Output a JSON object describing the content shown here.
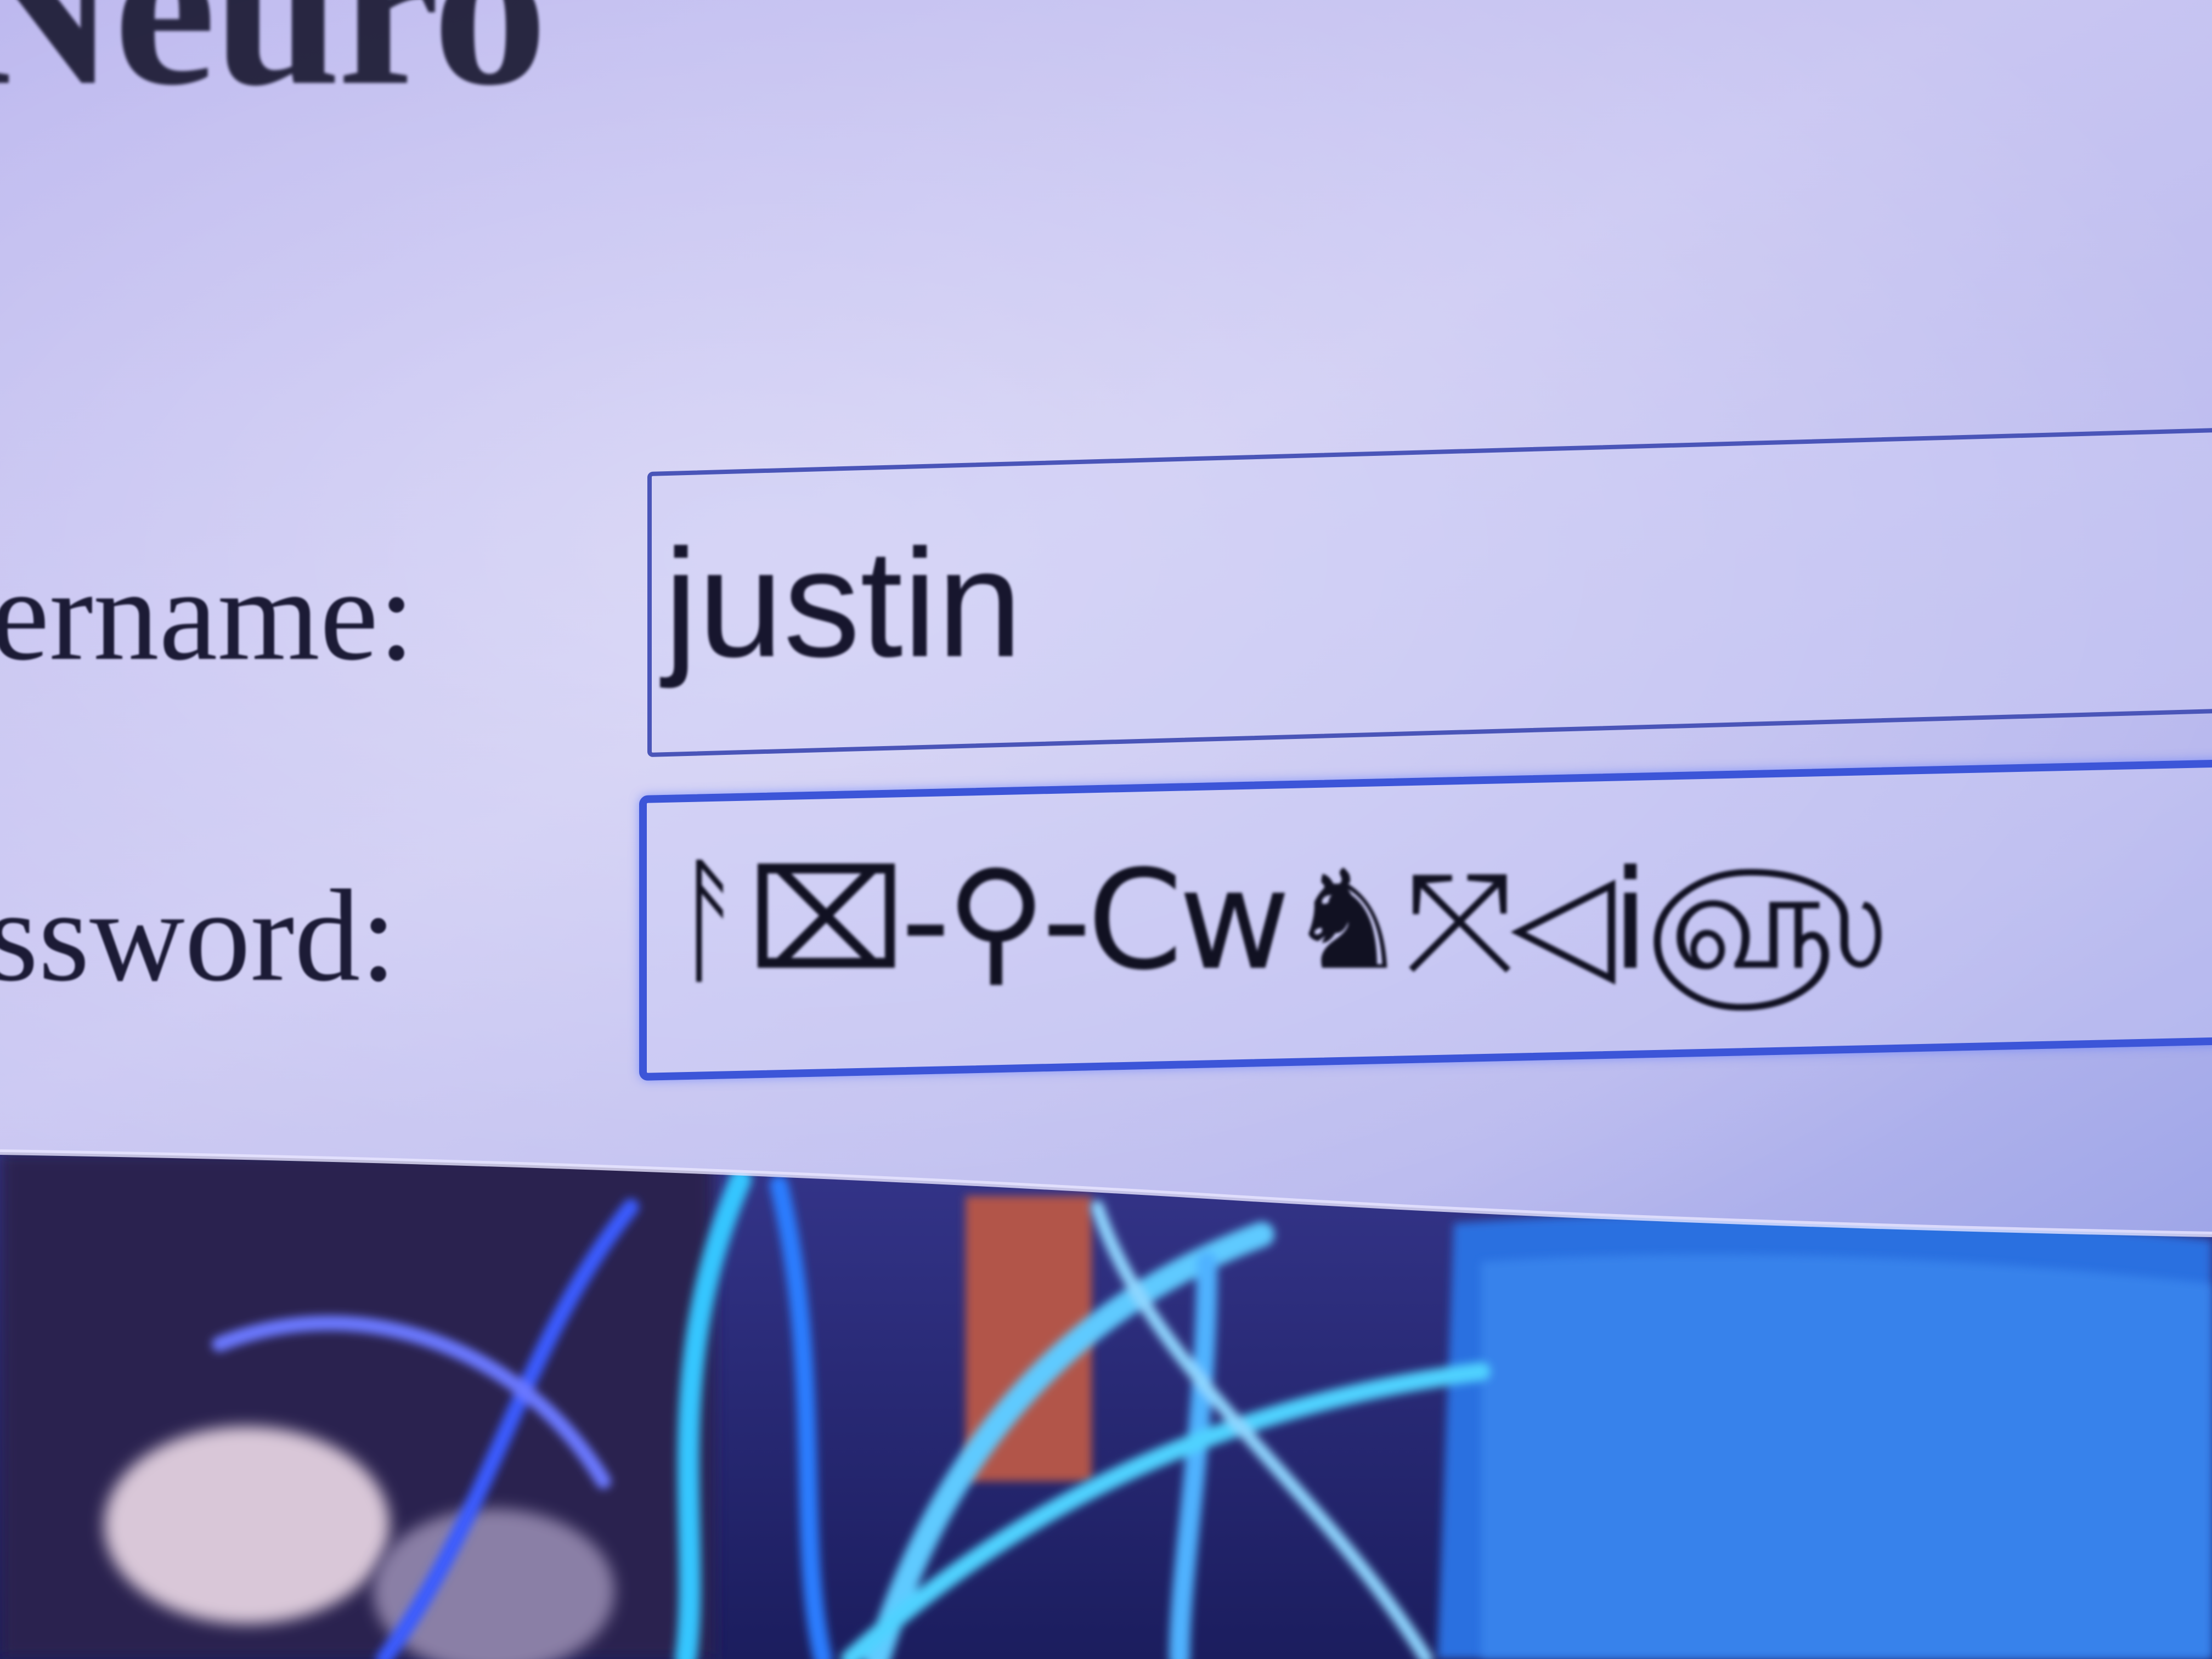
{
  "page": {
    "title_partial": "Neuro"
  },
  "login_form": {
    "username_label": "sername:",
    "username_value": "justin",
    "password_label": "assword:",
    "password_value": "ᚨ⌧‐⚲‐Cw♞⤧◁i௵"
  },
  "colors": {
    "screen_glow": "#c9c6f2",
    "input_border": "#4a55b8",
    "focused_input_border": "#3c55d8",
    "text": "#1c1b36"
  }
}
